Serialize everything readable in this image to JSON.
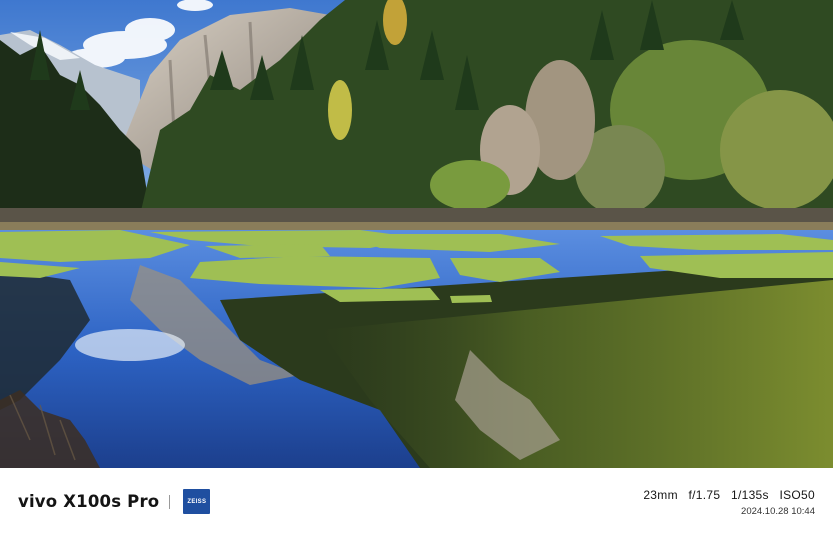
{
  "watermark": {
    "model": "vivo X100s Pro",
    "lens_brand": "ZEISS",
    "focal_length": "23mm",
    "aperture": "f/1.75",
    "shutter": "1/135s",
    "iso": "ISO50",
    "datetime": "2024.10.28 10:44",
    "colors": {
      "zeiss_blue": "#1f4fa0",
      "text": "#141414"
    }
  }
}
